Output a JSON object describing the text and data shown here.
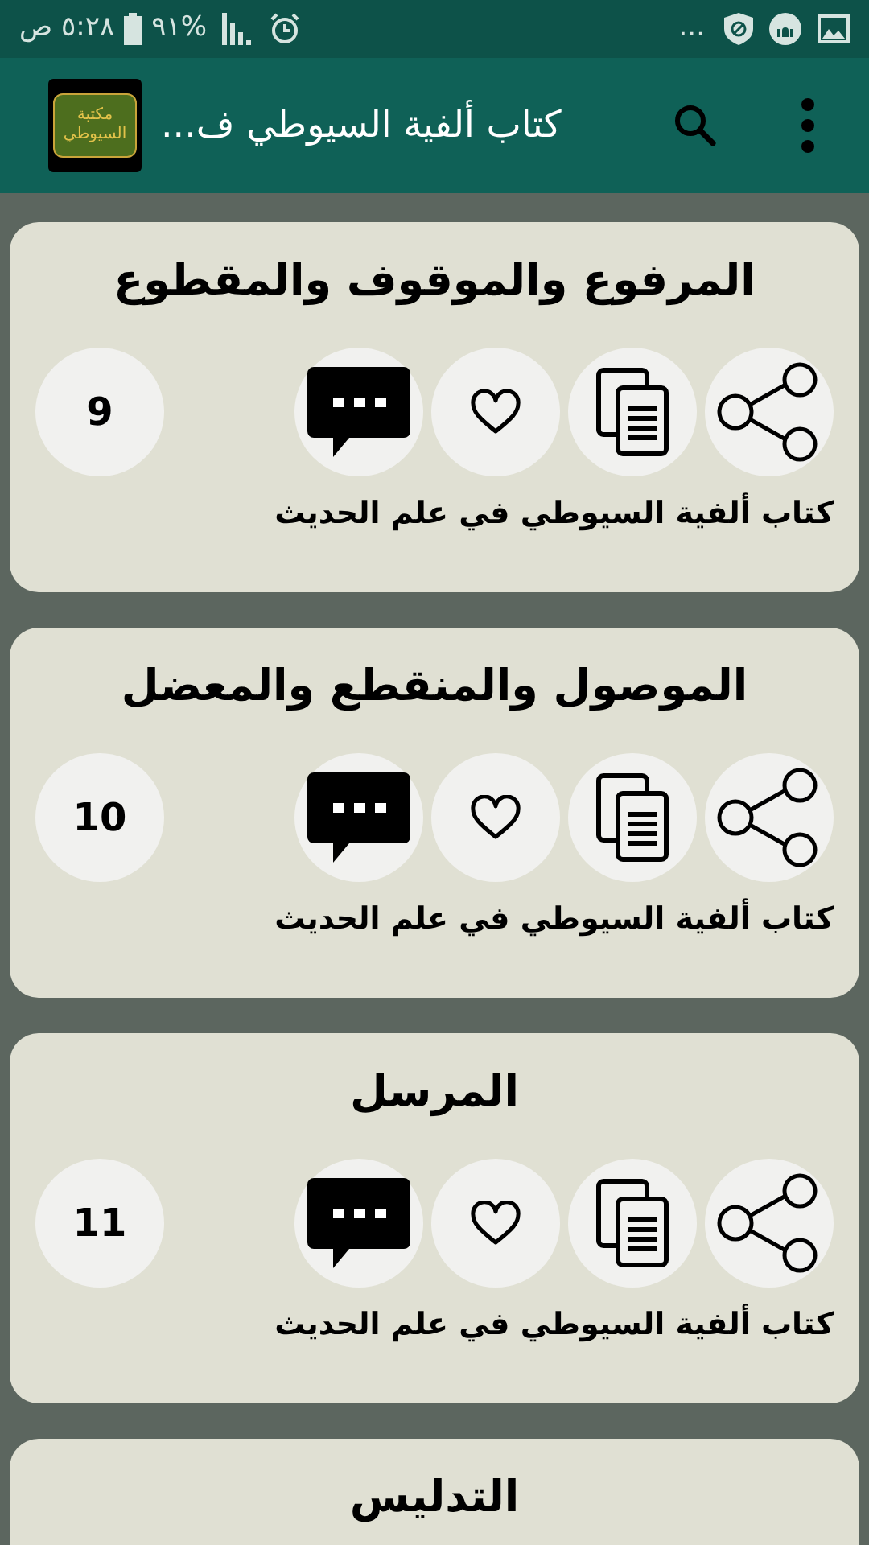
{
  "status_bar": {
    "time": "٥:٢٨ ص",
    "battery": "%٩١",
    "more": "..."
  },
  "app_bar": {
    "logo_lines": [
      "مكتبة",
      "السيوطي"
    ],
    "title": "كتاب ألفية السيوطي ف..."
  },
  "cards": [
    {
      "title": "المرفوع والموقوف والمقطوع",
      "count": "9",
      "book": "كتاب ألفية السيوطي في علم الحديث"
    },
    {
      "title": "الموصول والمنقطع والمعضل",
      "count": "10",
      "book": "كتاب ألفية السيوطي في علم الحديث"
    },
    {
      "title": "المرسل",
      "count": "11",
      "book": "كتاب ألفية السيوطي في علم الحديث"
    },
    {
      "title": "التدليس"
    }
  ]
}
